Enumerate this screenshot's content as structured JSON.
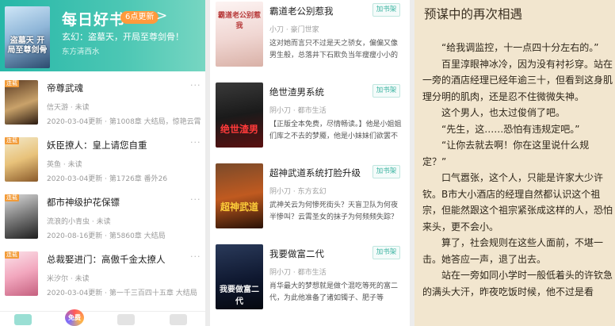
{
  "daily": {
    "title": "每日好书",
    "badge": "6点更新",
    "arrow": ">",
    "subtitle": "玄幻：盗墓天，开局至尊剑骨！",
    "author": "东方清西水",
    "cover_text": "盗墓天 开局至尊剑骨"
  },
  "shelf": [
    {
      "tag": "连载",
      "title": "帝尊武魂",
      "meta": "信天游 · 未读",
      "update": "2020-03-04更新 · 第1008章 大结局，惊艳云霄",
      "cover_text": "帝尊武魂"
    },
    {
      "tag": "连载",
      "title": "妖臣撩人：皇上请您自重",
      "meta": "英鱼 · 未读",
      "update": "2020-03-04更新 · 第1726章 番外26",
      "cover_text": "妖臣撩人"
    },
    {
      "tag": "连载",
      "title": "都市神级护花保镖",
      "meta": "流浪的小青虫 · 未读",
      "update": "2020-08-16更新 · 第5860章 大结局",
      "cover_text": "都市神级护花保镖"
    },
    {
      "tag": "连载",
      "title": "总裁娶进门：高傲千金太撩人",
      "meta": "米汐尔 · 未读",
      "update": "2020-03-04更新 · 第一千三百四十五章 大结局",
      "cover_text": "高傲千金太撩人"
    }
  ],
  "shelf_more": "···",
  "tabs": {
    "free_label": "免费"
  },
  "books": [
    {
      "title": "霸道老公别惹我",
      "button": "加书架",
      "author": "小刀 · 豪门世家",
      "desc": "这对她而言只不过是天之骄女，偏偏又像男生般，总落井下石欺负当年瘦瘦小小的他……一夕天……",
      "cover_text": "霸道老公别惹我"
    },
    {
      "title": "绝世渣男系统",
      "button": "加书架",
      "author": "阴小刀 · 都市生活",
      "desc": "【正版全本免费，尽情畅读。】他是小姐姐们库之不去的梦魇，他是小妹妹们欲罢不能的……",
      "cover_text": "绝世渣男"
    },
    {
      "title": "超神武道系统打脸升级",
      "button": "加书架",
      "author": "阴小刀 · 东方玄幻",
      "desc": "武神关云为何惨死街头？天盲卫队为何夜半惨叫？云霄圣女的抹子为何频频失踪？圣……",
      "cover_text": "超神武道"
    },
    {
      "title": "我要做富二代",
      "button": "加书架",
      "author": "阴小刀 · 都市生活",
      "desc": "肖华最大的梦想就是做个混吃等死的富二代，为此他准备了诸如镯子、肥子等物，……",
      "cover_text": "我要做富二代"
    }
  ],
  "reader": {
    "title": "预谋中的再次相遇",
    "paragraphs": [
      "“给我调监控，十一点四十分左右的。”",
      "百里淳眼神冰冷，因为没有衬衫穿。站在一旁的酒店经理已经年逾三十，但看到这身肌理分明的肌肉，还是忍不住微微失神。",
      "这个男人，也太过俊俏了吧。",
      "“先生，这……恐怕有违规定吧。”",
      "“让你去就去啊！你在这里说什么规定？”",
      "口气嚣张，这个人，只能是许家大少许钦。B市大小酒店的经理自然都认识这个祖宗，但能然跟这个祖宗紧张成这样的人，恐怕来头，更不会小。",
      "算了，社会规则在这些人面前，不堪一击。她答应一声，退了出去。",
      "站在一旁如同小学时一般低着头的许钦急的满头大汗，昨夜吃饭时候，他不过是看"
    ]
  },
  "colors": {
    "accent": "#27b7a8",
    "badge": "#ff9a3c",
    "reader_bg": "#f2e6cf",
    "tag": "#f29b38"
  }
}
